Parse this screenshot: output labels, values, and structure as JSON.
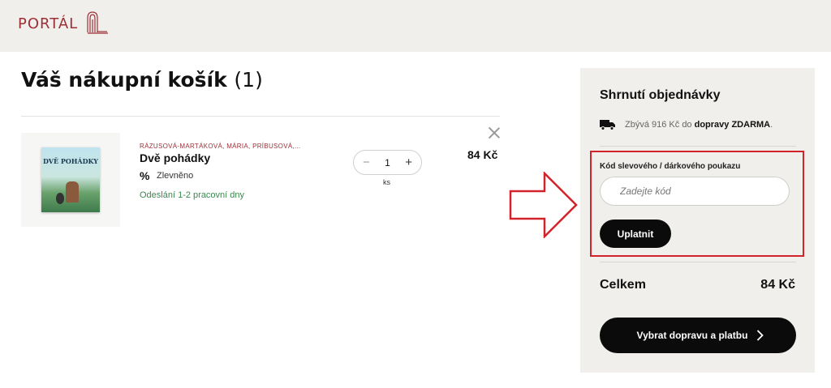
{
  "header": {
    "logo_text": "PORTÁL"
  },
  "cart": {
    "title": "Váš nákupní košík",
    "count": "(1)"
  },
  "item": {
    "author": "RÁZUSOVÁ-MARTÁKOVÁ, MÁRIA, PRÍBUSOVÁ,...",
    "name": "Dvě pohádky",
    "discount_label": "Zlevněno",
    "shipping_note": "Odeslání 1-2 pracovní dny",
    "quantity": "1",
    "unit": "ks",
    "price": "84 Kč",
    "cover_title": "DVĚ POHÁDKY"
  },
  "summary": {
    "title": "Shrnutí objednávky",
    "free_shipping_prefix": "Zbývá 916 Kč do ",
    "free_shipping_bold": "dopravy ZDARMA",
    "free_shipping_suffix": ".",
    "voucher_label": "Kód slevového / dárkového poukazu",
    "voucher_placeholder": "Zadejte kód",
    "apply_label": "Uplatnit",
    "total_label": "Celkem",
    "total_value": "84 Kč",
    "checkout_label": "Vybrat dopravu a platbu"
  },
  "colors": {
    "brand": "#9c2f35",
    "highlight": "#d2232a",
    "summary_bg": "#f1efec",
    "button_bg": "#0b0b0b",
    "shipping_green": "#3a8a4e"
  },
  "icons": [
    "portal-logo-icon",
    "discount-percent-icon",
    "minus-icon",
    "plus-icon",
    "close-icon",
    "truck-icon",
    "arrow-right-icon",
    "chevron-right-icon"
  ]
}
